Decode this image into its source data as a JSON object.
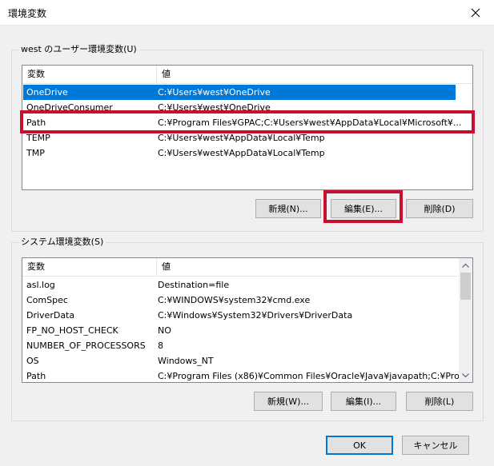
{
  "window": {
    "title": "環境変数",
    "close_icon": "×"
  },
  "user_env": {
    "group_title": "west のユーザー環境変数(U)",
    "columns": {
      "name": "変数",
      "value": "値"
    },
    "rows": [
      {
        "name": "OneDrive",
        "value": "C:¥Users¥west¥OneDrive"
      },
      {
        "name": "OneDriveConsumer",
        "value": "C:¥Users¥west¥OneDrive"
      },
      {
        "name": "Path",
        "value": "C:¥Program Files¥GPAC;C:¥Users¥west¥AppData¥Local¥Microsoft¥..."
      },
      {
        "name": "TEMP",
        "value": "C:¥Users¥west¥AppData¥Local¥Temp"
      },
      {
        "name": "TMP",
        "value": "C:¥Users¥west¥AppData¥Local¥Temp"
      }
    ],
    "buttons": {
      "new": "新規(N)...",
      "edit": "編集(E)...",
      "delete": "削除(D)"
    }
  },
  "system_env": {
    "group_title": "システム環境変数(S)",
    "columns": {
      "name": "変数",
      "value": "値"
    },
    "rows": [
      {
        "name": "asl.log",
        "value": "Destination=file"
      },
      {
        "name": "ComSpec",
        "value": "C:¥WINDOWS¥system32¥cmd.exe"
      },
      {
        "name": "DriverData",
        "value": "C:¥Windows¥System32¥Drivers¥DriverData"
      },
      {
        "name": "FP_NO_HOST_CHECK",
        "value": "NO"
      },
      {
        "name": "NUMBER_OF_PROCESSORS",
        "value": "8"
      },
      {
        "name": "OS",
        "value": "Windows_NT"
      },
      {
        "name": "Path",
        "value": "C:¥Program Files (x86)¥Common Files¥Oracle¥Java¥javapath;C:¥Pro..."
      }
    ],
    "buttons": {
      "new": "新規(W)...",
      "edit": "編集(I)...",
      "delete": "削除(L)"
    }
  },
  "dialog_buttons": {
    "ok": "OK",
    "cancel": "キャンセル"
  },
  "colors": {
    "selection": "#0078d7",
    "highlight": "#c8102e"
  }
}
